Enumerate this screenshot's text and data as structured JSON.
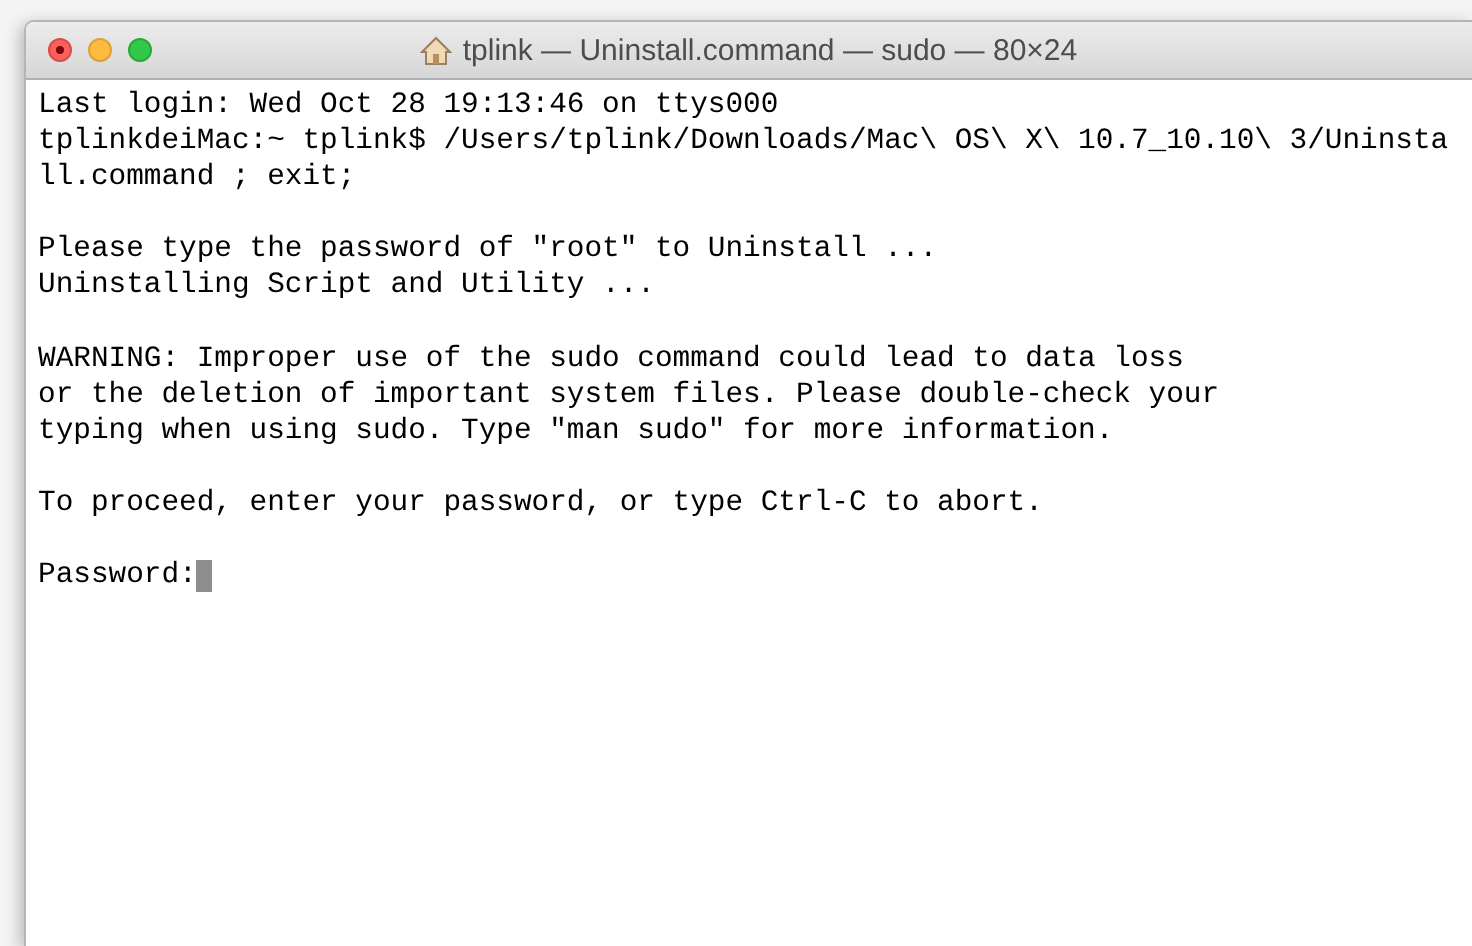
{
  "window": {
    "title": "tplink — Uninstall.command — sudo — 80×24"
  },
  "terminal": {
    "blocks": [
      [
        "Last login: Wed Oct 28 19:13:46 on ttys000",
        "tplinkdeiMac:~ tplink$ /Users/tplink/Downloads/Mac\\ OS\\ X\\ 10.7_10.10\\ 3/Uninsta",
        "ll.command ; exit;"
      ],
      [
        "Please type the password of \"root\" to Uninstall ...",
        "Uninstalling Script and Utility ..."
      ],
      [
        "WARNING: Improper use of the sudo command could lead to data loss",
        "or the deletion of important system files. Please double-check your",
        "typing when using sudo. Type \"man sudo\" for more information."
      ],
      [
        "To proceed, enter your password, or type Ctrl-C to abort."
      ]
    ],
    "prompt": "Password:"
  }
}
